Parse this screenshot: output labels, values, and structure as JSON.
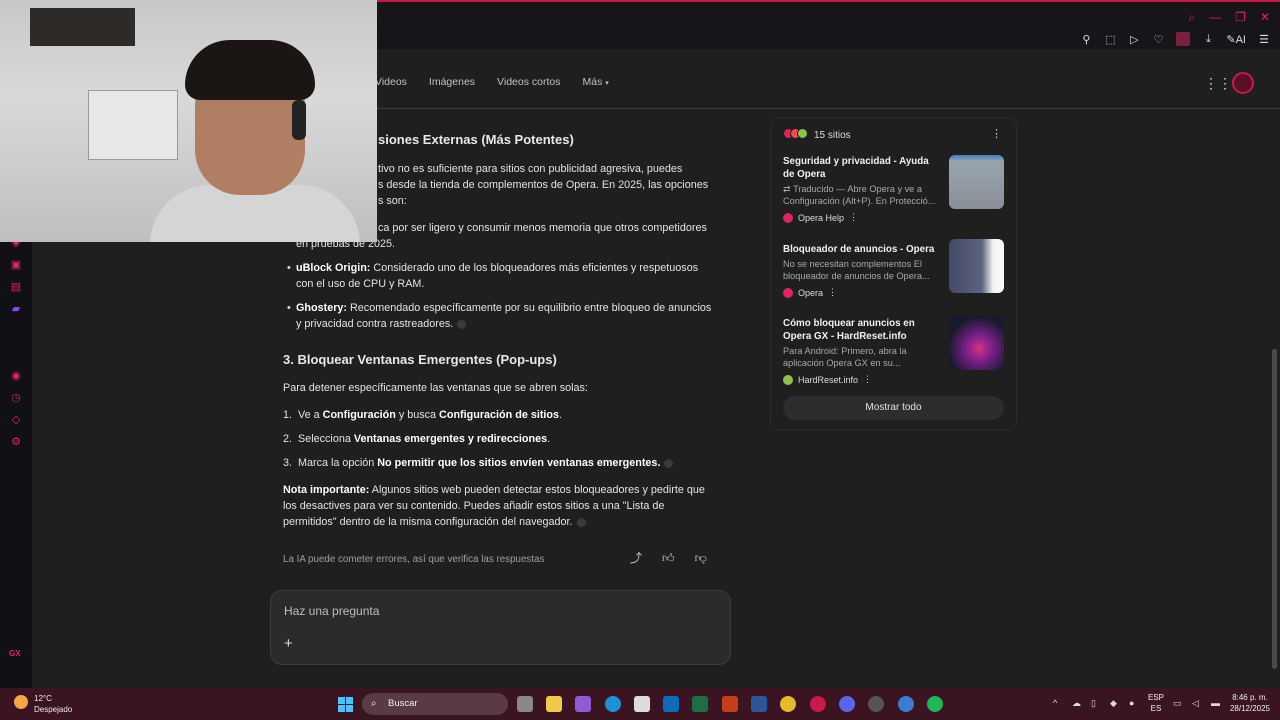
{
  "browser": {
    "toolbar_ai_label": "AI",
    "accent": "#c9184a"
  },
  "nav": {
    "tabs": [
      "Videos",
      "Imágenes",
      "Videos cortos",
      "Más"
    ]
  },
  "answer": {
    "section2_title_visible": "siones Externas (Más Potentes)",
    "section2_intro_line1": "tivo no es suficiente para sitios con publicidad agresiva, puedes",
    "section2_intro_line2": "s desde la tienda de complementos de Opera. En 2025, las opciones",
    "section2_intro_line3": "s son:",
    "item1_line1_visible": "ca por ser ligero y consumir menos memoria que otros competidores",
    "item1_line2": "en pruebas de 2025.",
    "item2_name": "uBlock Origin:",
    "item2_text_line1": "Considerado uno de los bloqueadores más eficientes y respetuosos",
    "item2_text_line2": "con el uso de CPU y RAM.",
    "item3_name": "Ghostery:",
    "item3_text_line1": "Recomendado específicamente por su equilibrio entre bloqueo de anuncios",
    "item3_text_line2": "y privacidad contra rastreadores.",
    "section3_title": "3. Bloquear Ventanas Emergentes (Pop-ups)",
    "section3_intro": "Para detener específicamente las ventanas que se abren solas:",
    "step1_a": "Ve a ",
    "step1_b": "Configuración",
    "step1_c": " y busca ",
    "step1_d": "Configuración de sitios",
    "step1_e": ".",
    "step2_a": "Selecciona ",
    "step2_b": "Ventanas emergentes y redirecciones",
    "step2_c": ".",
    "step3_a": "Marca la opción ",
    "step3_b": "No permitir que los sitios envíen ventanas emergentes.",
    "note_label": "Nota importante:",
    "note_line1": "Algunos sitios web pueden detectar estos bloqueadores y pedirte que",
    "note_line2": "los desactives para ver su contenido. Puedes añadir estos sitios a una \"Lista de",
    "note_line3": "permitidos\" dentro de la misma configuración del navegador.",
    "disclaimer": "La IA puede cometer errores, así que verifica las respuestas"
  },
  "ask": {
    "placeholder": "Haz una pregunta",
    "plus": "+"
  },
  "sources": {
    "count_label": "15 sitios",
    "items": [
      {
        "title": "Seguridad y privacidad - Ayuda de Opera",
        "snippet": "Traducido — Abre Opera y ve a Configuración (Alt+P). En Protecció...",
        "site": "Opera Help"
      },
      {
        "title": "Bloqueador de anuncios - Opera",
        "snippet": "No se necesitan complementos El bloqueador de anuncios de Opera...",
        "site": "Opera"
      },
      {
        "title": "Cómo bloquear anuncios en Opera GX - HardReset.info",
        "snippet": "Para Android: Primero, abra la aplicación Opera GX en su...",
        "site": "HardReset.info"
      }
    ],
    "show_all": "Mostrar todo"
  },
  "taskbar": {
    "temp": "12°C",
    "weather": "Despejado",
    "search": "Buscar",
    "lang_top": "ESP",
    "lang_bottom": "ES",
    "time": "8:46 p. m.",
    "date": "28/12/2025"
  },
  "sidebar": {
    "gx_label": "GX"
  }
}
